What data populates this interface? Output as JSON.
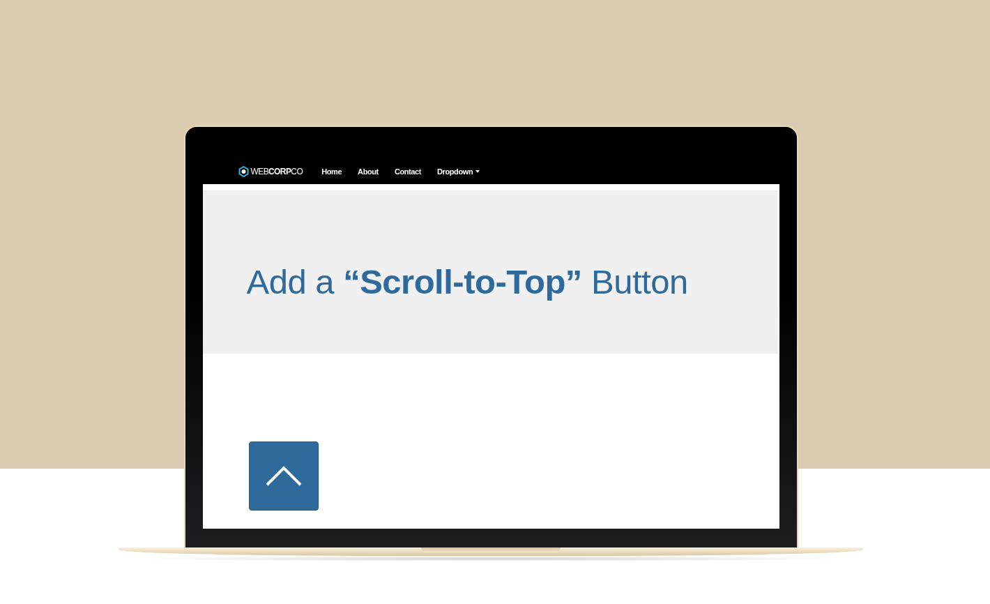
{
  "navbar": {
    "brand": "WEB**CORP**CO",
    "items": [
      {
        "label": "Home",
        "kind": "link"
      },
      {
        "label": "About",
        "kind": "link"
      },
      {
        "label": "Contact",
        "kind": "link"
      },
      {
        "label": "Dropdown",
        "kind": "dropdown"
      }
    ]
  },
  "hero": {
    "title": "Add a **“Scroll-to-Top”** Button"
  },
  "scroll_button": {
    "kind": "chevron-up"
  }
}
